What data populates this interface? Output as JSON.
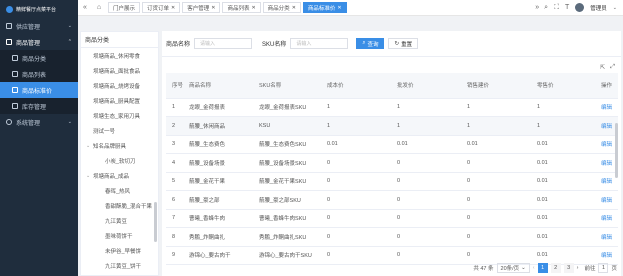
{
  "sidebar": {
    "logo_text": "精鲜餐厅点菜平台",
    "menus": [
      {
        "label": "供应管理",
        "icon": "truck-icon"
      },
      {
        "label": "商品管理",
        "icon": "grid-icon"
      }
    ],
    "sub_items": [
      {
        "label": "商品分类",
        "icon": "sliders-icon"
      },
      {
        "label": "商品列表",
        "icon": "list-icon"
      },
      {
        "label": "商品标准价",
        "icon": "tag-icon"
      },
      {
        "label": "库存管理",
        "icon": "box-icon"
      }
    ],
    "system": {
      "label": "系统管理",
      "icon": "gear-icon"
    }
  },
  "topbar": {
    "tabs": [
      {
        "label": "门户展示"
      },
      {
        "label": "订货订单"
      },
      {
        "label": "客户管理"
      },
      {
        "label": "商品列表"
      },
      {
        "label": "商品分类"
      },
      {
        "label": "商品标准价"
      }
    ],
    "user_name": "管理员"
  },
  "categories": {
    "header": "商品分类",
    "items": [
      {
        "label": "坝塘商品_休闲零食",
        "level": 1
      },
      {
        "label": "坝塘商品_面批食品",
        "level": 1
      },
      {
        "label": "坝塘商品_烧烤设备",
        "level": 1
      },
      {
        "label": "坝塘商品_厨具配置",
        "level": 1
      },
      {
        "label": "坝塘生态_家用刀具",
        "level": 1
      },
      {
        "label": "测试一号",
        "level": 1
      },
      {
        "label": "知名品牌厨具",
        "level": 1,
        "arrow": "⌄"
      },
      {
        "label": "小炭_软切刀",
        "level": 2
      },
      {
        "label": "坝塘商品_成品",
        "level": 1,
        "arrow": "⌄"
      },
      {
        "label": "春晖_热风",
        "level": 2
      },
      {
        "label": "香甜酥脆_混合干果",
        "level": 2
      },
      {
        "label": "九江黄豆",
        "level": 2
      },
      {
        "label": "墨味荷饼干",
        "level": 2
      },
      {
        "label": "未伊谷_早餐饼",
        "level": 2
      },
      {
        "label": "九江黄豆_饼干",
        "level": 2
      }
    ]
  },
  "search": {
    "name_label": "商品名称",
    "name_placeholder": "请输入",
    "sku_label": "SKU名称",
    "sku_placeholder": "请输入",
    "query_label": "查询",
    "reset_label": "重置"
  },
  "table": {
    "headers": [
      "序号",
      "商品名称",
      "SKU名称",
      "成本价",
      "批发价",
      "销售建价",
      "零售价",
      "操作"
    ],
    "edit_label": "编辑",
    "rows": [
      {
        "no": "1",
        "name": "龙眼_金荷报表",
        "sku": "龙眼_金荷报表SKU",
        "cost": "1",
        "wholesale": "1",
        "suggest": "1",
        "retail": "1"
      },
      {
        "no": "2",
        "name": "箭腰_休闲商品",
        "sku": "KSU",
        "cost": "1",
        "wholesale": "1",
        "suggest": "1",
        "retail": "1"
      },
      {
        "no": "3",
        "name": "箭腰_生态费色",
        "sku": "箭腰_生态费色SKU",
        "cost": "0.01",
        "wholesale": "0.01",
        "suggest": "0.01",
        "retail": "0.01"
      },
      {
        "no": "4",
        "name": "箭腰_设备场景",
        "sku": "箭腰_设备场景SKU",
        "cost": "0",
        "wholesale": "0",
        "suggest": "0",
        "retail": "0.01"
      },
      {
        "no": "5",
        "name": "箭腰_金花干果",
        "sku": "箭腰_金花干果SKU",
        "cost": "0",
        "wholesale": "0",
        "suggest": "0",
        "retail": "0.01"
      },
      {
        "no": "6",
        "name": "箭腰_豪之部",
        "sku": "箭腰_豪之部SKU",
        "cost": "0",
        "wholesale": "0",
        "suggest": "0",
        "retail": "0.01"
      },
      {
        "no": "7",
        "name": "曹曦_香蜂牛肉",
        "sku": "曹曦_香蜂牛肉SKU",
        "cost": "0",
        "wholesale": "0",
        "suggest": "0",
        "retail": "0.01"
      },
      {
        "no": "8",
        "name": "秀鹏_炸酮曲扎",
        "sku": "秀鹏_炸酮曲扎SKU",
        "cost": "0",
        "wholesale": "0",
        "suggest": "0",
        "retail": "0.01"
      },
      {
        "no": "9",
        "name": "游锦心_要古肉干",
        "sku": "游锦心_要古肉干SKU",
        "cost": "0",
        "wholesale": "0",
        "suggest": "0",
        "retail": "0.01"
      }
    ]
  },
  "pagination": {
    "total_text": "共 47 条",
    "page_size": "20条/页",
    "pages": [
      "1",
      "2",
      "3"
    ],
    "current_page": "1",
    "goto_label": "前往",
    "goto_value": "1",
    "page_suffix": "页"
  },
  "colors": {
    "primary": "#3a8ee6",
    "sidebar": "#1f2d3d"
  }
}
